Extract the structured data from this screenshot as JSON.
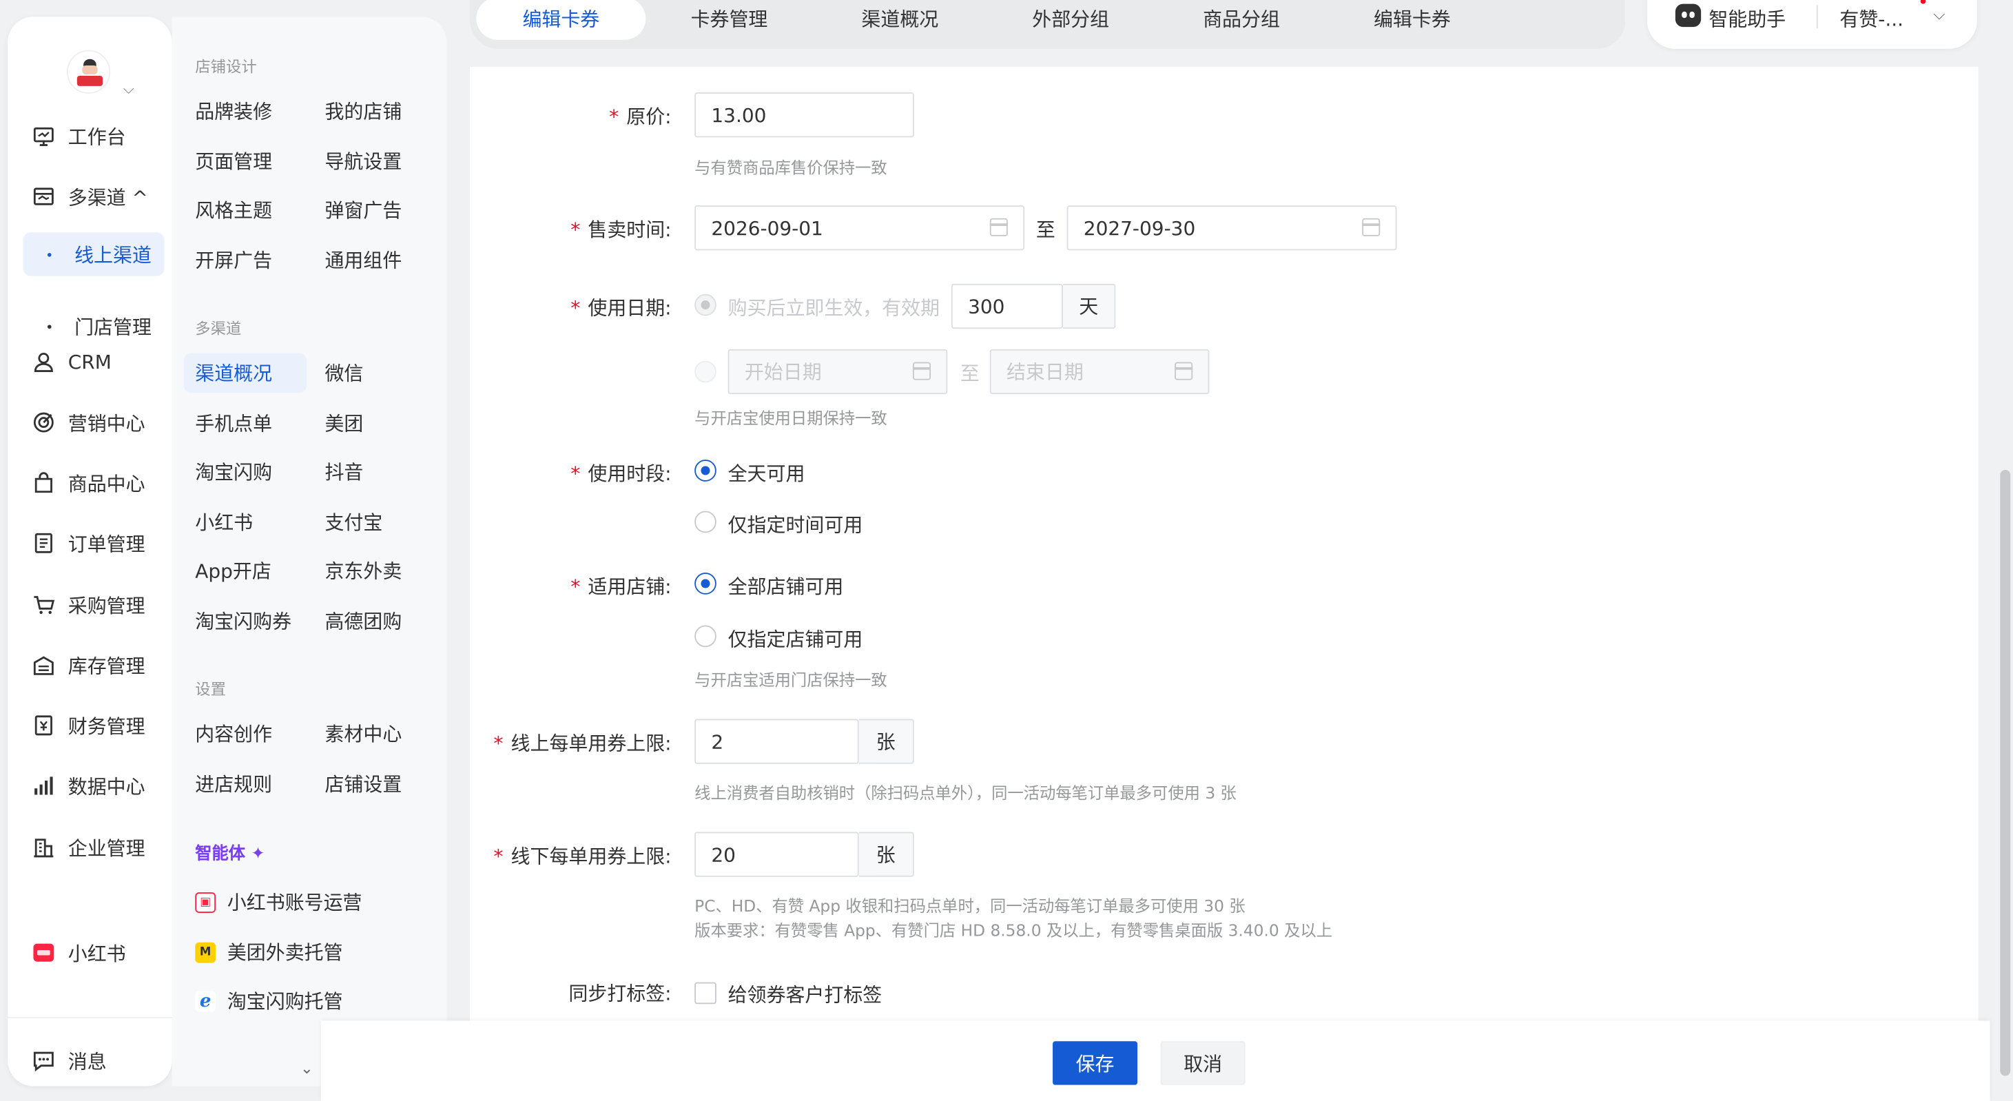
{
  "colors": {
    "primary": "#155bd4",
    "required": "#ee0a24",
    "agent": "#7b3ff2"
  },
  "tabs": [
    "编辑卡券",
    "卡券管理",
    "渠道概况",
    "外部分组",
    "商品分组",
    "编辑卡券"
  ],
  "assistant": {
    "label": "智能助手",
    "shop": "有赞-..."
  },
  "rail": {
    "items": [
      {
        "label": "工作台",
        "icon": "workbench-icon"
      },
      {
        "label": "多渠道 ^",
        "icon": "multichannel-icon"
      },
      {
        "label": "线上渠道"
      },
      {
        "label": "门店管理"
      },
      {
        "label": "CRM",
        "icon": "user-icon"
      },
      {
        "label": "营销中心",
        "icon": "target-icon"
      },
      {
        "label": "商品中心",
        "icon": "bag-icon"
      },
      {
        "label": "订单管理",
        "icon": "order-icon"
      },
      {
        "label": "采购管理",
        "icon": "cart-icon"
      },
      {
        "label": "库存管理",
        "icon": "warehouse-icon"
      },
      {
        "label": "财务管理",
        "icon": "finance-icon"
      },
      {
        "label": "数据中心",
        "icon": "bar-chart-icon"
      },
      {
        "label": "企业管理",
        "icon": "building-icon"
      },
      {
        "label": "小红书",
        "icon": "xiaohongshu-icon"
      },
      {
        "label": "消息",
        "icon": "message-icon"
      }
    ]
  },
  "panel": {
    "groups": [
      "店铺设计",
      "多渠道",
      "设置"
    ],
    "shop_design": [
      "品牌装修",
      "我的店铺",
      "页面管理",
      "导航设置",
      "风格主题",
      "弹窗广告",
      "开屏广告",
      "通用组件"
    ],
    "multichannel": [
      "渠道概况",
      "微信",
      "手机点单",
      "美团",
      "淘宝闪购",
      "抖音",
      "小红书",
      "支付宝",
      "App开店",
      "京东外卖",
      "淘宝闪购券",
      "高德团购"
    ],
    "settings": [
      "内容创作",
      "素材中心",
      "进店规则",
      "店铺设置"
    ],
    "agent_title": "智能体 ✦",
    "agents": [
      "小红书账号运营",
      "美团外卖托管",
      "淘宝闪购托管"
    ]
  },
  "form": {
    "original_price": {
      "label": "原价:",
      "value": "13.00",
      "hint": "与有赞商品库售价保持一致"
    },
    "sale_time": {
      "label": "售卖时间:",
      "start": "2026-09-01",
      "to": "至",
      "end": "2027-09-30"
    },
    "use_date": {
      "label": "使用日期:",
      "option1": "购买后立即生效，有效期",
      "days": "300",
      "unit": "天",
      "start_placeholder": "开始日期",
      "to": "至",
      "end_placeholder": "结束日期",
      "hint": "与开店宝使用日期保持一致"
    },
    "use_period": {
      "label": "使用时段:",
      "option1": "全天可用",
      "option2": "仅指定时间可用"
    },
    "stores": {
      "label": "适用店铺:",
      "option1": "全部店铺可用",
      "option2": "仅指定店铺可用",
      "hint": "与开店宝适用门店保持一致"
    },
    "online_limit": {
      "label": "线上每单用券上限:",
      "value": "2",
      "unit": "张",
      "hint": "线上消费者自助核销时（除扫码点单外），同一活动每笔订单最多可使用 3 张"
    },
    "offline_limit": {
      "label": "线下每单用券上限:",
      "value": "20",
      "unit": "张",
      "hint1": "PC、HD、有赞 App 收银和扫码点单时，同一活动每笔订单最多可使用 30 张",
      "hint2": "版本要求：有赞零售 App、有赞门店 HD 8.58.0 及以上，有赞零售桌面版 3.40.0 及以上"
    },
    "tagging": {
      "label": "同步打标签:",
      "option": "给领券客户打标签"
    }
  },
  "footer": {
    "save": "保存",
    "cancel": "取消"
  }
}
